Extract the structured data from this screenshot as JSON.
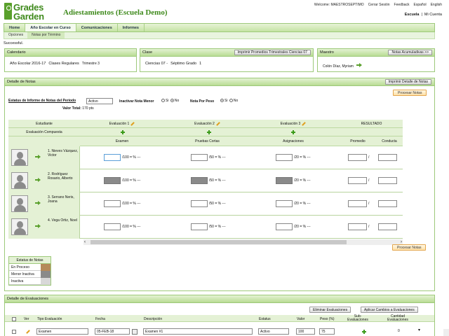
{
  "logo": {
    "line1": "Grades",
    "line2": "Garden"
  },
  "app_title": "Adiestamientos (Escuela Demo)",
  "top_links": [
    "Welcome: MAESTROSEPTIMO",
    "Cerrar Sesión",
    "Feedback",
    "Español",
    "English"
  ],
  "school_row": {
    "school": "Escuela",
    "sep": "|",
    "account": "Mi Cuenta"
  },
  "nav": [
    "Home",
    "Año Escolar en Curso",
    "Comunicaciones",
    "Informes"
  ],
  "subnav": [
    "Opciones",
    "Notas por Término"
  ],
  "status_msg": "Successful.",
  "calendario": {
    "title": "Calendario",
    "year": "Año Escolar 2016-17",
    "type": "Clases Regulares",
    "term": "Trimestre 3"
  },
  "clase": {
    "title": "Clase",
    "button": "Imprimir Promedios Trimestrales Ciencias 07",
    "name": "Ciencias 07 -",
    "grade": "Séptimo Grado",
    "section": "1"
  },
  "maestro": {
    "title": "Maestro",
    "button": "Notas Acumuladivas >>",
    "name": "Colón Díaz, Myriam"
  },
  "detalle": {
    "title": "Detalle de Notas",
    "print_button": "Imprimir Detalle de Notas",
    "process_button": "Procesar Notas",
    "estatus_label": "Estatus de Informe de Notas del Período",
    "estatus_value": "Activo",
    "inactivar_label": "Inactivar Nota Menor",
    "peso_label": "Nota Por Peso",
    "si": "Si",
    "no": "No",
    "valor_label": "Valor Total:",
    "valor_value": "170 pts",
    "col_estudiante": "Estudiante",
    "col_eval_compuesta": "Evaluación Compuesta",
    "evaluations": [
      "Evaluación 1",
      "Evaluación 2",
      "Evaluación 3"
    ],
    "col_resultado": "RESULTADO",
    "subcols": [
      "Examen",
      "Pruebas Cortas",
      "Asignaciones",
      "Promedio",
      "Conducta"
    ],
    "suffix": [
      "/100 = % ---",
      "/50 = % ---",
      "/20 = % ---"
    ],
    "slash": "/",
    "students": [
      {
        "name": "1. Nieves Vázquez, Victor",
        "status": "selected"
      },
      {
        "name": "2. Rodríguez Rosario, Alberto",
        "status": "inactive"
      },
      {
        "name": "3. Serrano Neris, Joana",
        "status": "normal"
      },
      {
        "name": "4. Vega Ortiz, Noel",
        "status": "normal"
      }
    ]
  },
  "legend": {
    "title": "Estatus de Notas",
    "items": [
      {
        "label": "En Proceso",
        "color": "#b58a5a"
      },
      {
        "label": "Menor Inactiva",
        "color": "#8a8a8a"
      },
      {
        "label": "Inactiva",
        "color": "#d8d8d8"
      }
    ]
  },
  "evaluaciones": {
    "title": "Detalle de Evaluaciones",
    "btn_delete": "Eliminar Evaluaciones",
    "btn_apply": "Aplicar Cambios a Evaluaciones",
    "headers": [
      "Ver",
      "Tipo Evaluación",
      "Fecha",
      "Descripción",
      "Estatus",
      "Valor",
      "Peso (%)",
      "Sub-Evaluaciones",
      "Cantidad Evaluaciones"
    ],
    "row": {
      "tipo": "Examen",
      "fecha": "05-FEB-18",
      "descripcion": "Examen #1",
      "estatus": "Activo",
      "valor": "100",
      "peso": "75",
      "cantidad": "0"
    }
  },
  "colors": {
    "accent": "#5aa02c",
    "header_green": "#c4e3a3",
    "orange": "#e3a64f"
  }
}
